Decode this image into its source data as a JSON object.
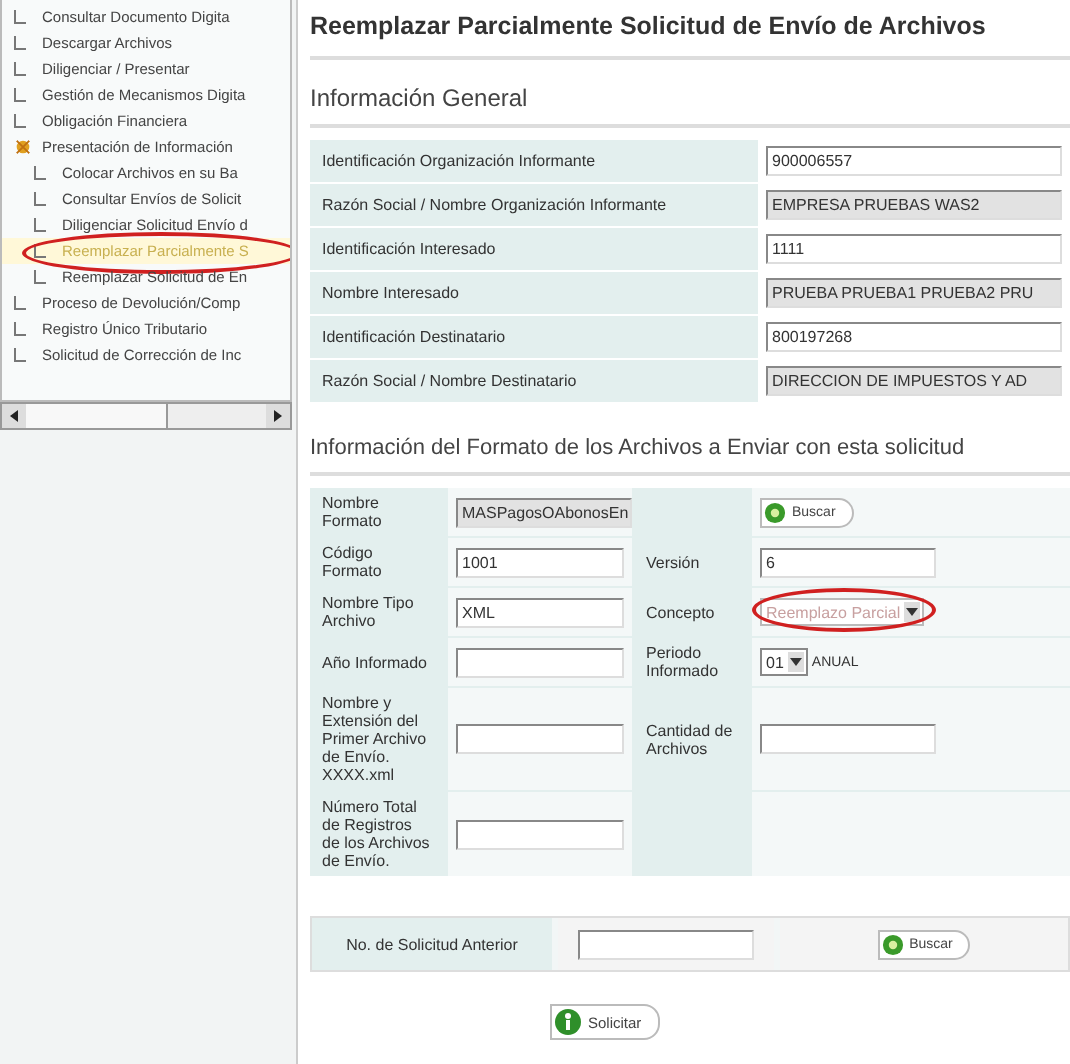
{
  "sidebar": {
    "items": [
      {
        "label": "Consultar Documento Digita",
        "selected": false
      },
      {
        "label": "Descargar Archivos",
        "selected": false
      },
      {
        "label": "Diligenciar / Presentar",
        "selected": false
      },
      {
        "label": "Gestión de Mecanismos Digita",
        "selected": false
      },
      {
        "label": "Obligación Financiera",
        "selected": false
      },
      {
        "label": "Presentación de Información",
        "selected": false,
        "expanded": true,
        "children": [
          {
            "label": "Colocar Archivos en su Ba",
            "selected": false
          },
          {
            "label": "Consultar Envíos de Solicit",
            "selected": false
          },
          {
            "label": "Diligenciar Solicitud Envío d",
            "selected": false
          },
          {
            "label": "Reemplazar Parcialmente S",
            "selected": true,
            "circled": true
          },
          {
            "label": "Reemplazar Solicitud de En",
            "selected": false
          }
        ]
      },
      {
        "label": "Proceso de Devolución/Comp",
        "selected": false
      },
      {
        "label": "Registro Único Tributario",
        "selected": false
      },
      {
        "label": "Solicitud de Corrección de Inc",
        "selected": false
      }
    ]
  },
  "page_title": "Reemplazar Parcialmente Solicitud de Envío de Archivos",
  "general": {
    "title": "Información General",
    "rows": [
      {
        "label": "Identificación Organización Informante",
        "value": "900006557",
        "readonly": false
      },
      {
        "label": "Razón Social / Nombre Organización Informante",
        "value": "EMPRESA PRUEBAS WAS2",
        "readonly": true
      },
      {
        "label": "Identificación Interesado",
        "value": "1111",
        "readonly": false
      },
      {
        "label": "Nombre Interesado",
        "value": "PRUEBA PRUEBA1 PRUEBA2 PRU",
        "readonly": true
      },
      {
        "label": "Identificación Destinatario",
        "value": "800197268",
        "readonly": false
      },
      {
        "label": "Razón Social / Nombre Destinatario",
        "value": "DIRECCION DE IMPUESTOS Y AD",
        "readonly": true
      }
    ]
  },
  "format": {
    "title": "Información del Formato de los Archivos a Enviar con esta solicitud",
    "rows": [
      {
        "left": {
          "label": "Nombre Formato",
          "field": {
            "kind": "input",
            "value": "MASPagosOAbonosEn",
            "readonly": true
          }
        },
        "right": {
          "field": {
            "kind": "button",
            "label": "Buscar"
          }
        }
      },
      {
        "left": {
          "label": "Código Formato",
          "field": {
            "kind": "input",
            "value": "1001",
            "readonly": false
          }
        },
        "right": {
          "label": "Versión",
          "field": {
            "kind": "input",
            "value": "6",
            "readonly": false
          }
        }
      },
      {
        "left": {
          "label": "Nombre Tipo Archivo",
          "field": {
            "kind": "input",
            "value": "XML",
            "readonly": false
          }
        },
        "right": {
          "label": "Concepto",
          "field": {
            "kind": "select",
            "value": "Reemplazo Parcial",
            "disabled": true,
            "circled": true
          }
        }
      },
      {
        "left": {
          "label": "Año Informado",
          "field": {
            "kind": "input",
            "readonly": false
          }
        },
        "right": {
          "label": "Periodo Informado",
          "field": {
            "kind": "select",
            "value": "01",
            "disabled": false,
            "suffix": "ANUAL"
          }
        }
      },
      {
        "left": {
          "label": "Nombre y Extensión del Primer Archivo de Envío. XXXX.xml",
          "field": {
            "kind": "input",
            "readonly": false
          }
        },
        "right": {
          "label": "Cantidad de Archivos",
          "field": {
            "kind": "input",
            "readonly": false
          }
        }
      },
      {
        "left": {
          "label": "Número Total de Registros de los Archivos de Envío.",
          "field": {
            "kind": "input",
            "readonly": false
          }
        },
        "right": {}
      }
    ]
  },
  "previous": {
    "label": "No. de Solicitud Anterior",
    "button": "Buscar"
  },
  "submit": "Solicitar"
}
